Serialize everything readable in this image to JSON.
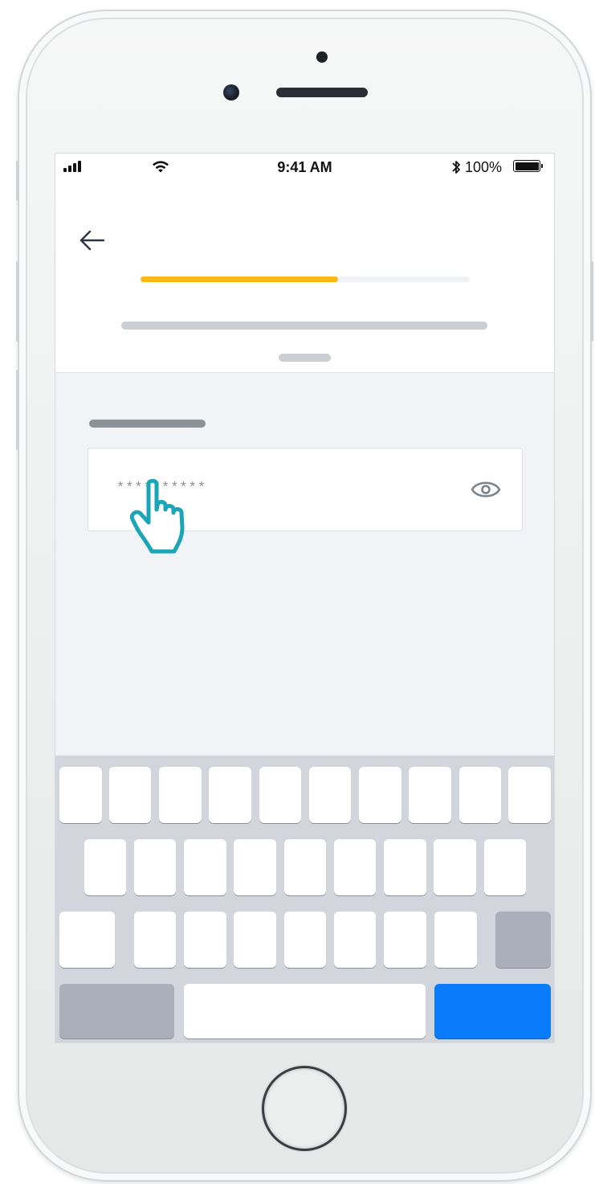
{
  "status_bar": {
    "time": "9:41 AM",
    "battery_percent": "100%",
    "icons": [
      "signal-icon",
      "wifi-icon",
      "bluetooth-icon",
      "battery-icon"
    ]
  },
  "header": {
    "back_icon": "back-arrow-icon",
    "progress": 0.6,
    "progress_color": "#FDB913",
    "track_color": "#F2F3F7"
  },
  "password_field": {
    "value": "**********",
    "toggle_icon": "eye-icon"
  },
  "keyboard": {
    "return_key_color": "#0A7BFB"
  },
  "colors": {
    "accent": "#FDB913",
    "pointer": "#1AA5B8"
  }
}
